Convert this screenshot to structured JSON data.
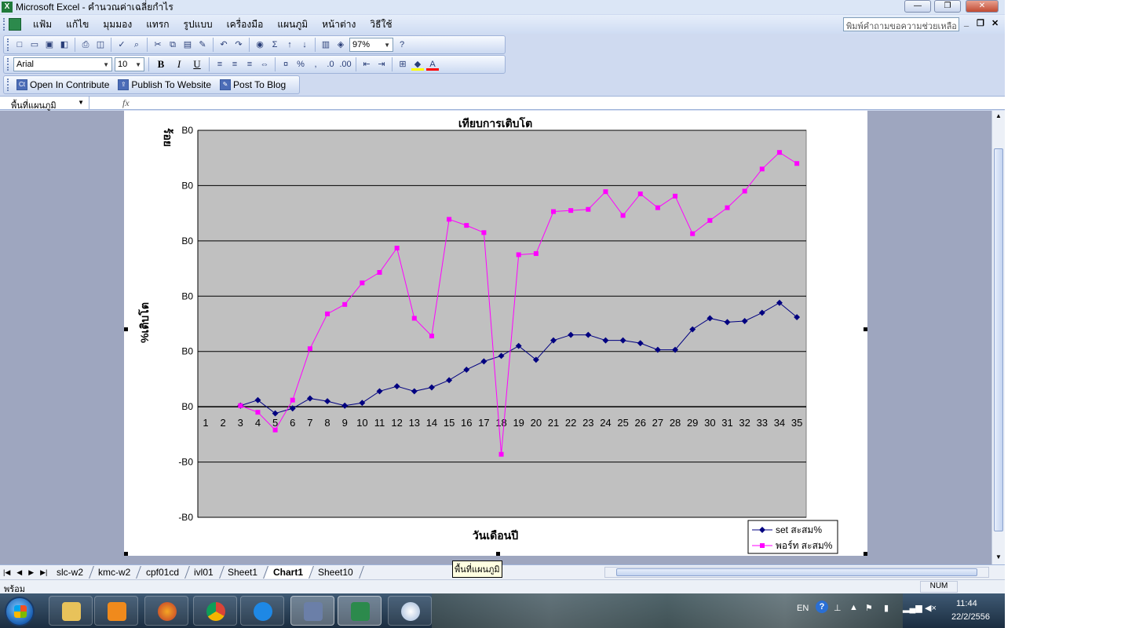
{
  "window": {
    "title": "Microsoft Excel - คำนวณค่าเฉลี่ยกำไร"
  },
  "menu": {
    "items": [
      "แฟ้ม",
      "แก้ไข",
      "มุมมอง",
      "แทรก",
      "รูปแบบ",
      "เครื่องมือ",
      "แผนภูมิ",
      "หน้าต่าง",
      "วิธีใช้"
    ],
    "help_placeholder": "พิมพ์คำถามขอความช่วยเหลือ"
  },
  "toolbar": {
    "zoom": "97%"
  },
  "formatting": {
    "font": "Arial",
    "size": "10",
    "bold": "B",
    "italic": "I",
    "underline": "U"
  },
  "contribute": {
    "open": "Open In Contribute",
    "publish": "Publish To Website",
    "blog": "Post To Blog"
  },
  "namebox": {
    "value": "พื้นที่แผนภูมิ",
    "fx": "fx"
  },
  "chart_data": {
    "type": "line",
    "title": "เทียบการเติบโต",
    "xlabel": "วันเดือนปี",
    "ylabel": "%เติบโต",
    "y2label": "ร้อย",
    "ytick_labels": [
      "B0",
      "B0",
      "B0",
      "B0",
      "B0",
      "B0",
      "-B0",
      "-B0"
    ],
    "categories": [
      1,
      2,
      3,
      4,
      5,
      6,
      7,
      8,
      9,
      10,
      11,
      12,
      13,
      14,
      15,
      16,
      17,
      18,
      19,
      20,
      21,
      22,
      23,
      24,
      25,
      26,
      27,
      28,
      29,
      30,
      31,
      32,
      33,
      34,
      35
    ],
    "ylim": [
      -2,
      5
    ],
    "grid": true,
    "legend": "bottom-right",
    "series": [
      {
        "name": "set สะสม%",
        "color": "#000080",
        "values": [
          null,
          null,
          0.02,
          0.12,
          -0.12,
          -0.03,
          0.15,
          0.1,
          0.02,
          0.07,
          0.28,
          0.37,
          0.28,
          0.35,
          0.48,
          0.67,
          0.82,
          0.92,
          1.1,
          0.85,
          1.2,
          1.3,
          1.3,
          1.2,
          1.2,
          1.15,
          1.03,
          1.03,
          1.4,
          1.6,
          1.53,
          1.55,
          1.7,
          1.88,
          1.62
        ]
      },
      {
        "name": "พอร์ท สะสม%",
        "color": "#ff00ff",
        "values": [
          null,
          null,
          0.02,
          -0.1,
          -0.42,
          0.12,
          1.05,
          1.68,
          1.85,
          2.24,
          2.43,
          2.87,
          1.6,
          1.28,
          3.39,
          3.28,
          3.15,
          -0.86,
          2.75,
          2.77,
          3.53,
          3.55,
          3.57,
          3.89,
          3.46,
          3.85,
          3.6,
          3.81,
          3.13,
          3.37,
          3.6,
          3.9,
          4.3,
          4.6,
          4.4
        ]
      }
    ]
  },
  "tooltip": "พื้นที่แผนภูมิ",
  "sheets": [
    "slc-w2",
    "kmc-w2",
    "cpf01cd",
    "ivl01",
    "Sheet1",
    "Chart1",
    "Sheet10"
  ],
  "active_sheet": "Chart1",
  "status": {
    "text": "พร้อม",
    "num": "NUM"
  },
  "tray": {
    "lang": "EN",
    "time": "11:44",
    "date": "22/2/2556"
  }
}
